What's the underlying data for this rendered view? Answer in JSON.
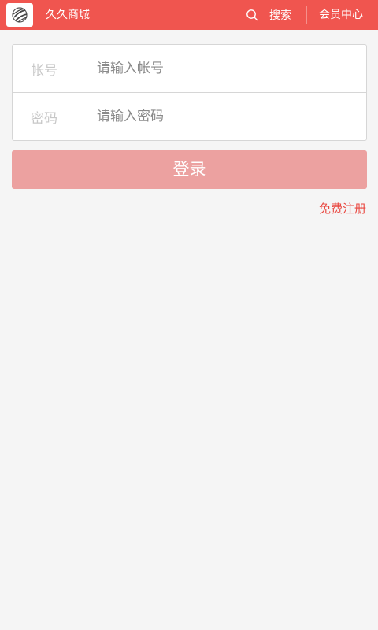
{
  "header": {
    "logo_icon": "globe-logo-icon",
    "title": "久久商城",
    "search_icon": "search-icon",
    "search_label": "搜索",
    "member_center_label": "会员中心",
    "color": "#f0554f"
  },
  "login_form": {
    "account": {
      "label": "帐号",
      "value": "",
      "placeholder": "请输入帐号"
    },
    "password": {
      "label": "密码",
      "value": "",
      "placeholder": "请输入密码"
    },
    "login_button_label": "登录",
    "login_button_color": "#eca1a0",
    "register_link_label": "免费注册",
    "register_link_color": "#e9463f"
  }
}
